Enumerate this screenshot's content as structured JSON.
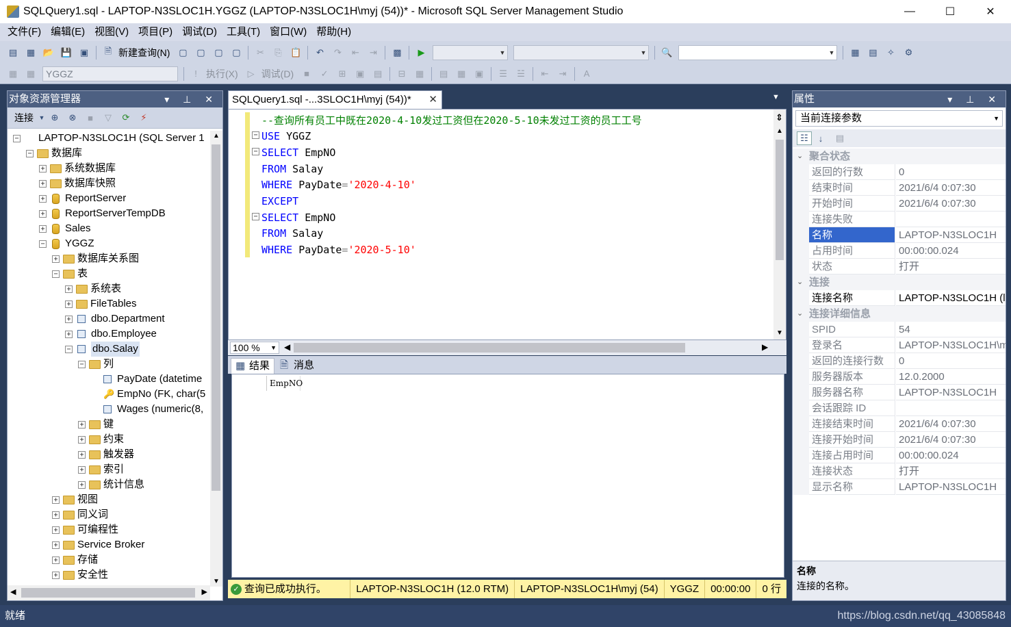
{
  "window": {
    "title": "SQLQuery1.sql - LAPTOP-N3SLOC1H.YGGZ (LAPTOP-N3SLOC1H\\myj (54))* - Microsoft SQL Server Management Studio",
    "minimize": "—",
    "maximize": "☐",
    "close": "✕"
  },
  "menu": [
    "文件(F)",
    "编辑(E)",
    "视图(V)",
    "项目(P)",
    "调试(D)",
    "工具(T)",
    "窗口(W)",
    "帮助(H)"
  ],
  "toolbar": {
    "new_query": "新建查询(N)",
    "database": "YGGZ",
    "execute": "执行(X)",
    "debug": "调试(D)"
  },
  "object_explorer": {
    "title": "对象资源管理器",
    "connect": "连接",
    "tree": [
      {
        "label": "LAPTOP-N3SLOC1H (SQL Server 1",
        "level": 0,
        "icon": "server",
        "toggle": "−"
      },
      {
        "label": "数据库",
        "level": 1,
        "icon": "folder",
        "toggle": "−"
      },
      {
        "label": "系统数据库",
        "level": 2,
        "icon": "folder",
        "toggle": "+"
      },
      {
        "label": "数据库快照",
        "level": 2,
        "icon": "folder",
        "toggle": "+"
      },
      {
        "label": "ReportServer",
        "level": 2,
        "icon": "db",
        "toggle": "+"
      },
      {
        "label": "ReportServerTempDB",
        "level": 2,
        "icon": "db",
        "toggle": "+"
      },
      {
        "label": "Sales",
        "level": 2,
        "icon": "db",
        "toggle": "+"
      },
      {
        "label": "YGGZ",
        "level": 2,
        "icon": "db",
        "toggle": "−"
      },
      {
        "label": "数据库关系图",
        "level": 3,
        "icon": "folder",
        "toggle": "+"
      },
      {
        "label": "表",
        "level": 3,
        "icon": "folder",
        "toggle": "−"
      },
      {
        "label": "系统表",
        "level": 4,
        "icon": "folder",
        "toggle": "+"
      },
      {
        "label": "FileTables",
        "level": 4,
        "icon": "folder",
        "toggle": "+"
      },
      {
        "label": "dbo.Department",
        "level": 4,
        "icon": "col",
        "toggle": "+"
      },
      {
        "label": "dbo.Employee",
        "level": 4,
        "icon": "col",
        "toggle": "+"
      },
      {
        "label": "dbo.Salay",
        "level": 4,
        "icon": "col",
        "toggle": "−",
        "selected": true
      },
      {
        "label": "列",
        "level": 5,
        "icon": "folder",
        "toggle": "−"
      },
      {
        "label": "PayDate (datetime",
        "level": 6,
        "icon": "col",
        "toggle": ""
      },
      {
        "label": "EmpNo (FK, char(5",
        "level": 6,
        "icon": "key",
        "toggle": ""
      },
      {
        "label": "Wages (numeric(8,",
        "level": 6,
        "icon": "col",
        "toggle": ""
      },
      {
        "label": "键",
        "level": 5,
        "icon": "folder",
        "toggle": "+"
      },
      {
        "label": "约束",
        "level": 5,
        "icon": "folder",
        "toggle": "+"
      },
      {
        "label": "触发器",
        "level": 5,
        "icon": "folder",
        "toggle": "+"
      },
      {
        "label": "索引",
        "level": 5,
        "icon": "folder",
        "toggle": "+"
      },
      {
        "label": "统计信息",
        "level": 5,
        "icon": "folder",
        "toggle": "+"
      },
      {
        "label": "视图",
        "level": 3,
        "icon": "folder",
        "toggle": "+"
      },
      {
        "label": "同义词",
        "level": 3,
        "icon": "folder",
        "toggle": "+"
      },
      {
        "label": "可编程性",
        "level": 3,
        "icon": "folder",
        "toggle": "+"
      },
      {
        "label": "Service Broker",
        "level": 3,
        "icon": "folder",
        "toggle": "+"
      },
      {
        "label": "存储",
        "level": 3,
        "icon": "folder",
        "toggle": "+"
      },
      {
        "label": "安全性",
        "level": 3,
        "icon": "folder",
        "toggle": "+"
      }
    ]
  },
  "editor": {
    "tab_label": "SQLQuery1.sql -...3SLOC1H\\myj (54))*",
    "zoom": "100 %",
    "comment": "--查询所有员工中既在2020-4-10发过工资但在2020-5-10未发过工资的员工工号",
    "kw_use": "USE",
    "db": "YGGZ",
    "kw_select": "SELECT",
    "col": "EmpNO",
    "kw_from": "FROM",
    "table": "Salay",
    "kw_where": "WHERE",
    "paydate": "PayDate",
    "eq": "=",
    "date1": "'2020-4-10'",
    "kw_except": "EXCEPT",
    "date2": "'2020-5-10'"
  },
  "results": {
    "tab_results": "结果",
    "tab_messages": "消息",
    "column_header": "EmpNO"
  },
  "query_status": {
    "message": "查询已成功执行。",
    "server": "LAPTOP-N3SLOC1H (12.0 RTM)",
    "user": "LAPTOP-N3SLOC1H\\myj (54)",
    "database": "YGGZ",
    "time": "00:00:00",
    "rows": "0 行"
  },
  "properties": {
    "title": "属性",
    "selector": "当前连接参数",
    "categories": [
      {
        "name": "聚合状态",
        "rows": [
          {
            "name": "返回的行数",
            "value": "0"
          },
          {
            "name": "结束时间",
            "value": "2021/6/4 0:07:30"
          },
          {
            "name": "开始时间",
            "value": "2021/6/4 0:07:30"
          },
          {
            "name": "连接失败",
            "value": ""
          },
          {
            "name": "名称",
            "value": "LAPTOP-N3SLOC1H",
            "selected": true
          },
          {
            "name": "占用时间",
            "value": "00:00:00.024"
          },
          {
            "name": "状态",
            "value": "打开"
          }
        ]
      },
      {
        "name": "连接",
        "rows": [
          {
            "name": "连接名称",
            "value": "LAPTOP-N3SLOC1H (l",
            "dark": true
          }
        ]
      },
      {
        "name": "连接详细信息",
        "rows": [
          {
            "name": "SPID",
            "value": "54"
          },
          {
            "name": "登录名",
            "value": "LAPTOP-N3SLOC1H\\m"
          },
          {
            "name": "返回的连接行数",
            "value": "0"
          },
          {
            "name": "服务器版本",
            "value": "12.0.2000"
          },
          {
            "name": "服务器名称",
            "value": "LAPTOP-N3SLOC1H"
          },
          {
            "name": "会话跟踪 ID",
            "value": ""
          },
          {
            "name": "连接结束时间",
            "value": "2021/6/4 0:07:30"
          },
          {
            "name": "连接开始时间",
            "value": "2021/6/4 0:07:30"
          },
          {
            "name": "连接占用时间",
            "value": "00:00:00.024"
          },
          {
            "name": "连接状态",
            "value": "打开"
          },
          {
            "name": "显示名称",
            "value": "LAPTOP-N3SLOC1H"
          }
        ]
      }
    ],
    "desc_title": "名称",
    "desc_text": "连接的名称。"
  },
  "statusbar": {
    "text": "就绪"
  },
  "watermark": "https://blog.csdn.net/qq_43085848"
}
